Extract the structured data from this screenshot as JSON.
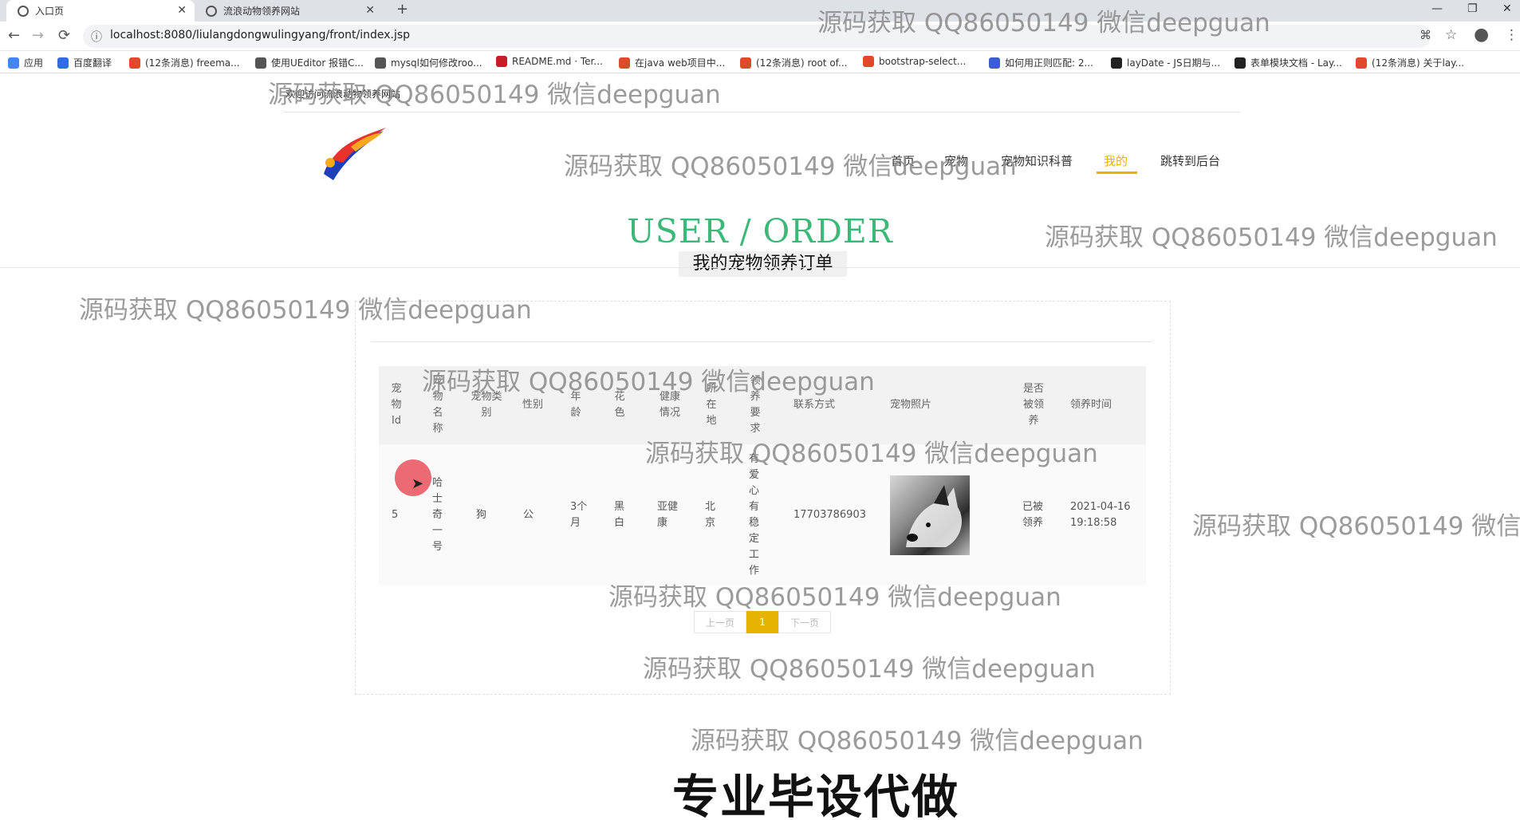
{
  "browser": {
    "tabs": [
      {
        "title": "入口页",
        "close": "✕"
      },
      {
        "title": "流浪动物领养网站",
        "close": "✕"
      }
    ],
    "new_tab": "+",
    "window_controls": [
      "—",
      "❐",
      "✕"
    ],
    "url": "localhost:8080/liulangdongwulingyang/front/index.jsp",
    "nav": {
      "back": "←",
      "forward": "→",
      "reload": "⟳",
      "info": "ⓘ"
    },
    "toolbar_icons": {
      "translate": "⌘",
      "star": "☆",
      "profile": "●",
      "menu": "⋮"
    },
    "bookmarks": [
      {
        "label": "应用",
        "color": "#4285f4"
      },
      {
        "label": "百度翻译",
        "color": "#2f6ce5"
      },
      {
        "label": "(12条消息) freema...",
        "color": "#e2482b"
      },
      {
        "label": "使用UEditor 报错C...",
        "color": "#555555"
      },
      {
        "label": "mysql如何修改roo...",
        "color": "#555555"
      },
      {
        "label": "README.md · Ter...",
        "color": "#c71d23"
      },
      {
        "label": "在java web项目中...",
        "color": "#e2482b"
      },
      {
        "label": "(12条消息) root of...",
        "color": "#e2482b"
      },
      {
        "label": "bootstrap-select...",
        "color": "#e2482b"
      },
      {
        "label": "如何用正则匹配: 2...",
        "color": "#3b5bdb"
      },
      {
        "label": "layDate - JS日期与...",
        "color": "#222222"
      },
      {
        "label": "表单模块文档 - Lay...",
        "color": "#222222"
      },
      {
        "label": "(12条消息) 关于lay...",
        "color": "#e2482b"
      }
    ]
  },
  "page": {
    "welcome": "欢迎访问流浪动物领养网站",
    "nav": [
      "首页",
      "宠物",
      "宠物知识科普",
      "我的",
      "跳转到后台"
    ],
    "active_nav": "我的",
    "title_en": "USER / ORDER",
    "title_cn": "我的宠物领养订单",
    "accent_color": "#e6b300",
    "title_color": "#3cb878"
  },
  "table": {
    "headers": [
      "宠物Id",
      "宠物名称",
      "宠物类别",
      "性别",
      "年龄",
      "花色",
      "健康情况",
      "所在地",
      "领养要求",
      "联系方式",
      "宠物照片",
      "是否被领养",
      "领养时间"
    ],
    "rows": [
      {
        "id": "5",
        "name": "哈士奇一号",
        "category": "狗",
        "gender": "公",
        "age": "3个月",
        "color": "黑白",
        "health": "亚健康",
        "location": "北京",
        "requirement": "有爱心有稳定工作",
        "contact": "17703786903",
        "photo_alt": "husky-photo",
        "adopted": "已被领养",
        "time": "2021-04-16 19:18:58"
      }
    ]
  },
  "pagination": {
    "prev": "上一页",
    "current": "1",
    "next": "下一页"
  },
  "watermark": "源码获取 QQ86050149 微信deepguan",
  "watermark_cut": "源码获取 QQ86050149 微信d",
  "promo": "专业毕设代做"
}
